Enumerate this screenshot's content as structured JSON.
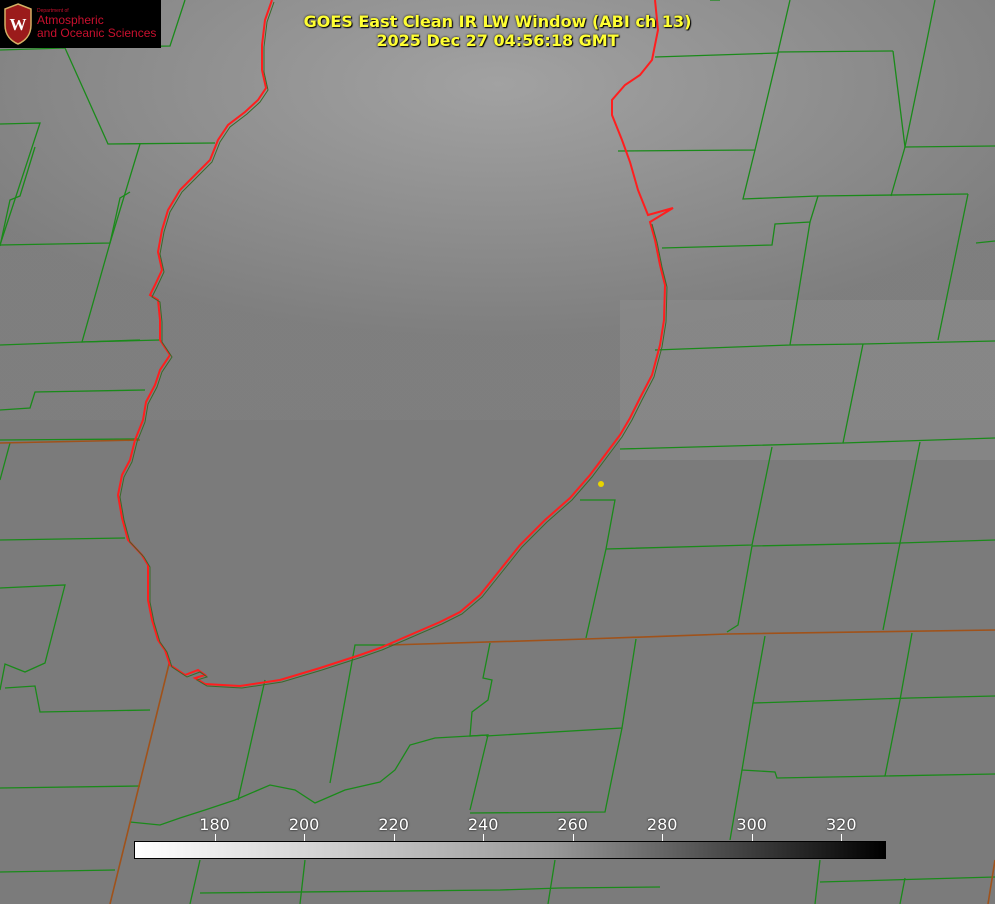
{
  "header": {
    "title_line1": "GOES East Clean IR LW Window (ABI ch 13)",
    "title_line2": "2025 Dec 27 04:56:18 GMT"
  },
  "logo": {
    "department": "Department of",
    "line1": "Atmospheric",
    "line2": "and Oceanic Sciences",
    "seal_letter": "W"
  },
  "colorbar": {
    "units_min": 162,
    "units_max": 330,
    "tick_labels": [
      "180",
      "200",
      "220",
      "240",
      "260",
      "280",
      "300",
      "320"
    ],
    "tick_values": [
      180,
      200,
      220,
      240,
      260,
      280,
      300,
      320
    ]
  },
  "map": {
    "lake_outline_color": "#ff2020",
    "county_line_color": "#1a8a1a",
    "state_line_color": "#a0521a",
    "marker_color": "#ffdd00"
  }
}
